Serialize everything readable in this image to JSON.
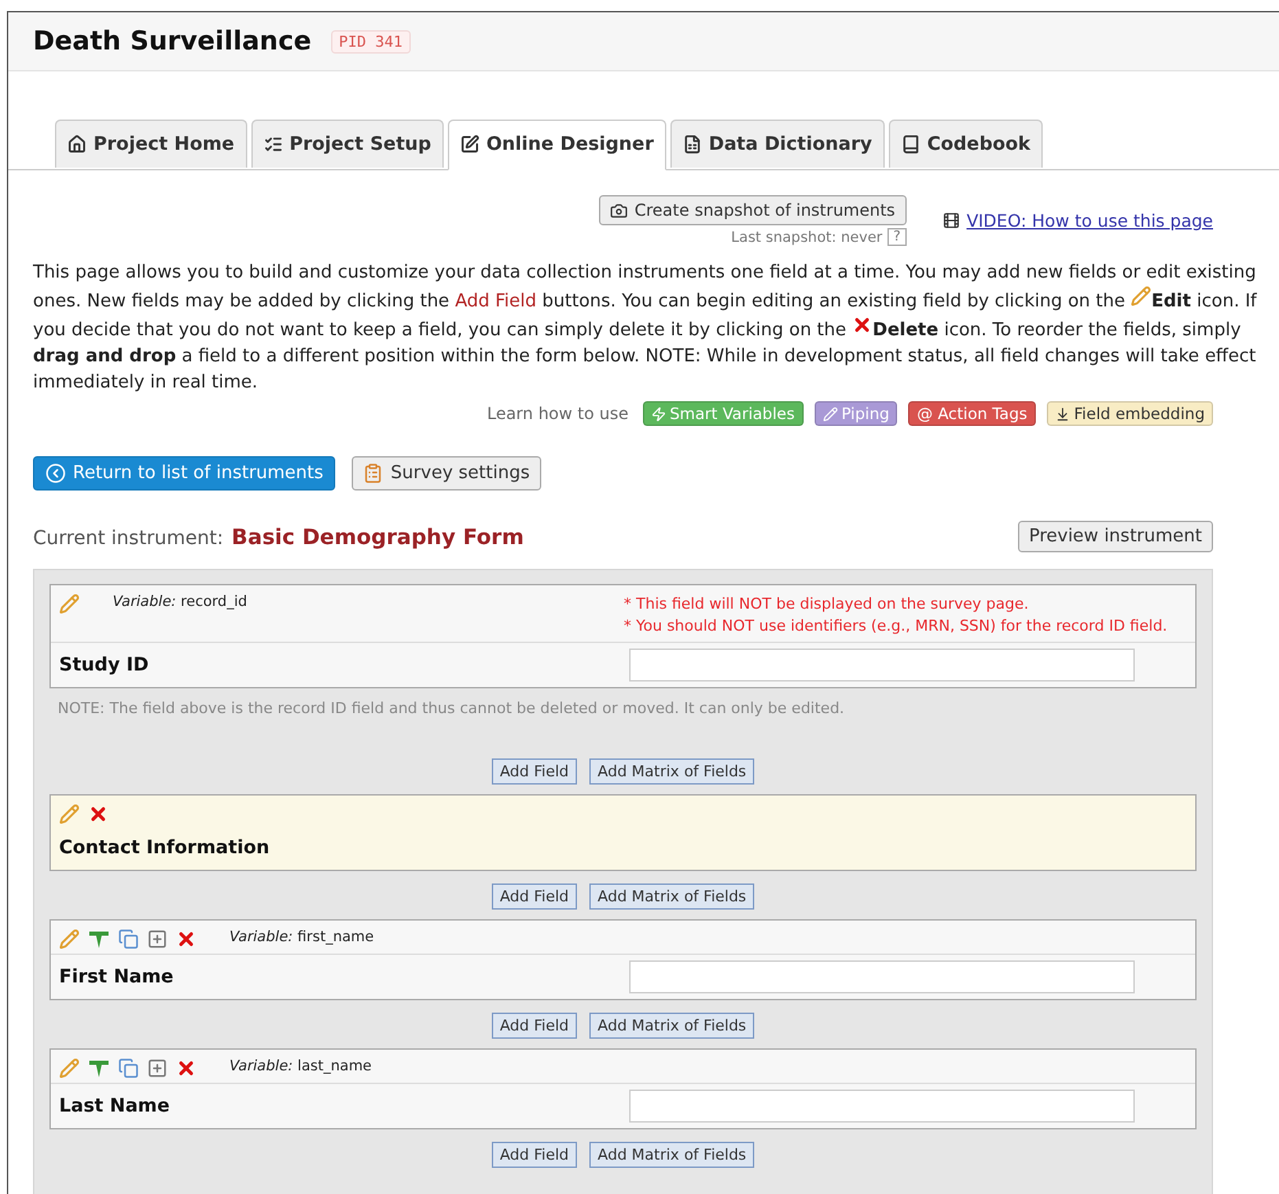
{
  "project": {
    "title": "Death Surveillance",
    "pid": "PID 341"
  },
  "tabs": [
    {
      "label": "Project Home",
      "kind": "home",
      "selected": false
    },
    {
      "label": "Project Setup",
      "kind": "setup",
      "selected": false
    },
    {
      "label": "Online Designer",
      "kind": "designer",
      "selected": true
    },
    {
      "label": "Data Dictionary",
      "kind": "dictionary",
      "selected": false
    },
    {
      "label": "Codebook",
      "kind": "codebook",
      "selected": false
    }
  ],
  "snapshot": {
    "button": "Create snapshot of instruments",
    "last": "Last snapshot: never",
    "help": "?"
  },
  "video_link": "VIDEO: How to use this page",
  "intro": [
    {
      "kind": "text",
      "text": "This page allows you to build and customize your data collection instruments one field at a time. You may add new fields or edit existing ones. New fields may be added by clicking the "
    },
    {
      "kind": "red",
      "text": "Add Field"
    },
    {
      "kind": "text",
      "text": " buttons. You can begin editing an existing field by clicking on the "
    },
    {
      "kind": "pencil"
    },
    {
      "kind": "bold",
      "text": "Edit"
    },
    {
      "kind": "text",
      "text": " icon. If you decide that you do not want to keep a field, you can simply delete it by clicking on the "
    },
    {
      "kind": "delete"
    },
    {
      "kind": "bold",
      "text": "Delete"
    },
    {
      "kind": "text",
      "text": " icon. To reorder the fields, simply "
    },
    {
      "kind": "bold",
      "text": "drag and drop"
    },
    {
      "kind": "text",
      "text": " a field to a different position within the form below. NOTE: While in development status, all field changes will take effect immediately in real time."
    }
  ],
  "learn": {
    "label": "Learn how to use",
    "badges": [
      {
        "text": "Smart Variables",
        "kind": "smart",
        "color": "#5cb85c"
      },
      {
        "text": "Piping",
        "kind": "piping",
        "color": "#a999d6"
      },
      {
        "text": "@ Action Tags",
        "kind": "tags",
        "color": "#d9534f"
      },
      {
        "text": "Field embedding",
        "kind": "embed",
        "color": "#f8ecc4"
      }
    ]
  },
  "buttons": {
    "return": "Return to list of instruments",
    "survey": "Survey settings",
    "preview": "Preview instrument"
  },
  "instrument": {
    "label": "Current instrument:",
    "name": "Basic Demography Form"
  },
  "fields": [
    {
      "kind": "record",
      "variable_label": "Variable:",
      "variable": "record_id",
      "label": "Study ID",
      "notes": [
        "* This field will NOT be displayed on the survey page.",
        "* You should NOT use identifiers (e.g., MRN, SSN) for the record ID field."
      ],
      "note": "NOTE: The field above is the record ID field and thus cannot be deleted or moved. It can only be edited.",
      "add_field": "Add Field",
      "add_matrix": "Add Matrix of Fields"
    },
    {
      "kind": "section",
      "label": "Contact Information",
      "add_field": "Add Field",
      "add_matrix": "Add Matrix of Fields"
    },
    {
      "kind": "field",
      "variable_label": "Variable:",
      "variable": "first_name",
      "label": "First Name",
      "add_field": "Add Field",
      "add_matrix": "Add Matrix of Fields"
    },
    {
      "kind": "field",
      "variable_label": "Variable:",
      "variable": "last_name",
      "label": "Last Name",
      "add_field": "Add Field",
      "add_matrix": "Add Matrix of Fields"
    }
  ]
}
